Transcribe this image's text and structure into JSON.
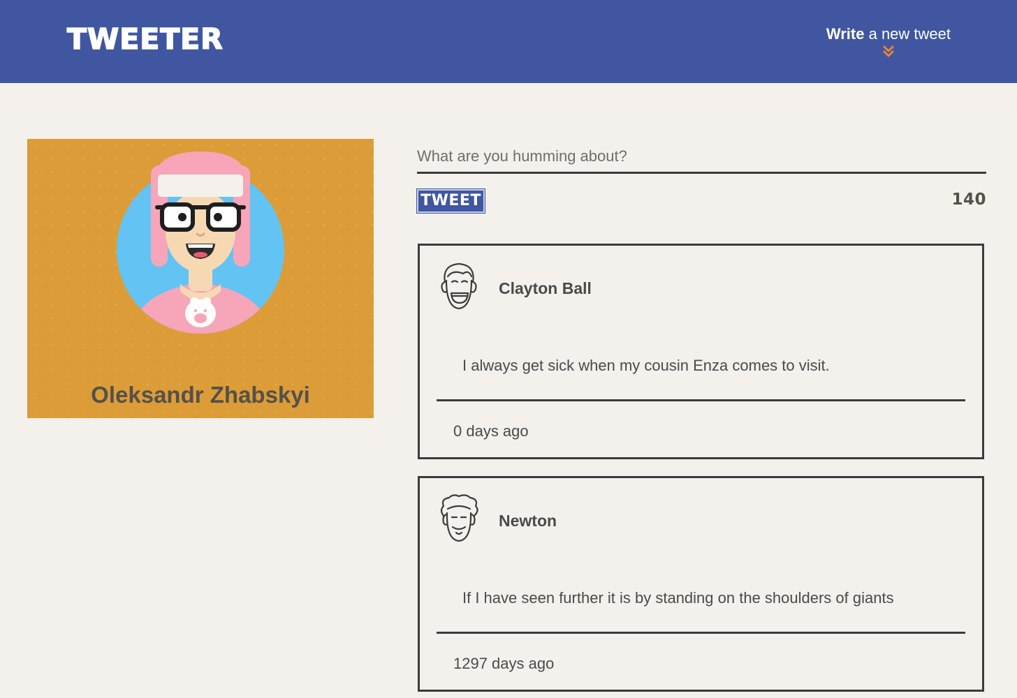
{
  "header": {
    "brand": "TWEETER",
    "compose_bold": "Write",
    "compose_rest": " a new tweet",
    "compose_icon": "double-chevron-down-icon",
    "background_color": "#4056a1",
    "accent_color": "#f0803c"
  },
  "profile": {
    "name": "Oleksandr Zhabskyi",
    "background_color": "#dc9c38"
  },
  "composer": {
    "placeholder": "What are you humming about?",
    "button_label": "TWEET",
    "char_counter": "140"
  },
  "tweets": [
    {
      "user": "Clayton Ball",
      "avatar_icon": "smiling-face-icon",
      "text": "I always get sick when my cousin Enza comes to visit.",
      "age": "0 days ago"
    },
    {
      "user": "Newton",
      "avatar_icon": "curly-hair-face-icon",
      "text": "If I have seen further it is by standing on the shoulders of giants",
      "age": "1297 days ago"
    }
  ]
}
